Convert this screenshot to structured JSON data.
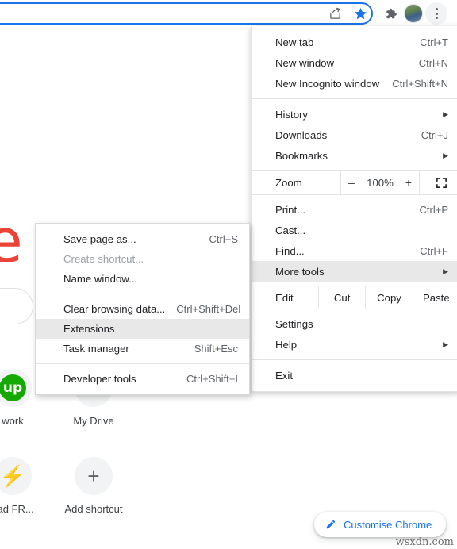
{
  "toolbar": {
    "omnibox_value": "",
    "omnibox_placeholder": "",
    "share_icon": "share-icon",
    "star_icon": "bookmark-star-icon",
    "extensions_icon": "puzzle-extensions-icon",
    "avatar_icon": "profile-avatar",
    "menu_icon": "three-dot-menu-icon"
  },
  "newtab": {
    "logo_fragment": "e",
    "tiles": [
      {
        "label": "work",
        "glyph": "up",
        "icon": "upwork-icon"
      },
      {
        "label": "My Drive",
        "glyph": "",
        "icon": "drive-icon"
      },
      {
        "label": "oad FR...",
        "glyph": "⚡",
        "icon": "zap-icon"
      },
      {
        "label": "Add shortcut",
        "glyph": "+",
        "icon": "plus-icon"
      }
    ],
    "customise_button": "Customise Chrome",
    "customise_icon": "pencil-icon"
  },
  "main_menu": {
    "items": [
      {
        "label": "New tab",
        "accel": "Ctrl+T",
        "arrow": false
      },
      {
        "label": "New window",
        "accel": "Ctrl+N",
        "arrow": false
      },
      {
        "label": "New Incognito window",
        "accel": "Ctrl+Shift+N",
        "arrow": false
      },
      {
        "label": "History",
        "accel": "",
        "arrow": true
      },
      {
        "label": "Downloads",
        "accel": "Ctrl+J",
        "arrow": false
      },
      {
        "label": "Bookmarks",
        "accel": "",
        "arrow": true
      },
      {
        "label": "Print...",
        "accel": "Ctrl+P",
        "arrow": false
      },
      {
        "label": "Cast...",
        "accel": "",
        "arrow": false
      },
      {
        "label": "Find...",
        "accel": "Ctrl+F",
        "arrow": false
      },
      {
        "label": "More tools",
        "accel": "",
        "arrow": true,
        "highlighted": true
      },
      {
        "label": "Settings",
        "accel": "",
        "arrow": false
      },
      {
        "label": "Help",
        "accel": "",
        "arrow": true
      },
      {
        "label": "Exit",
        "accel": "",
        "arrow": false
      }
    ],
    "zoom_row": {
      "label": "Zoom",
      "minus": "–",
      "value": "100%",
      "plus": "+",
      "fullscreen_icon": "fullscreen-icon"
    },
    "edit_row": {
      "label": "Edit",
      "cut": "Cut",
      "copy": "Copy",
      "paste": "Paste"
    }
  },
  "submenu": {
    "items": [
      {
        "label": "Save page as...",
        "accel": "Ctrl+S",
        "disabled": false
      },
      {
        "label": "Create shortcut...",
        "accel": "",
        "disabled": true
      },
      {
        "label": "Name window...",
        "accel": "",
        "disabled": false
      },
      {
        "label": "Clear browsing data...",
        "accel": "Ctrl+Shift+Del",
        "disabled": false
      },
      {
        "label": "Extensions",
        "accel": "",
        "disabled": false,
        "highlighted": true
      },
      {
        "label": "Task manager",
        "accel": "Shift+Esc",
        "disabled": false
      },
      {
        "label": "Developer tools",
        "accel": "Ctrl+Shift+I",
        "disabled": false
      }
    ]
  },
  "watermark": "wsxdn.com",
  "colors": {
    "accent_blue": "#1a73e8",
    "logo_red": "#EA4335",
    "highlight_grey": "#e8e8e8",
    "upwork_green": "#14a800"
  }
}
